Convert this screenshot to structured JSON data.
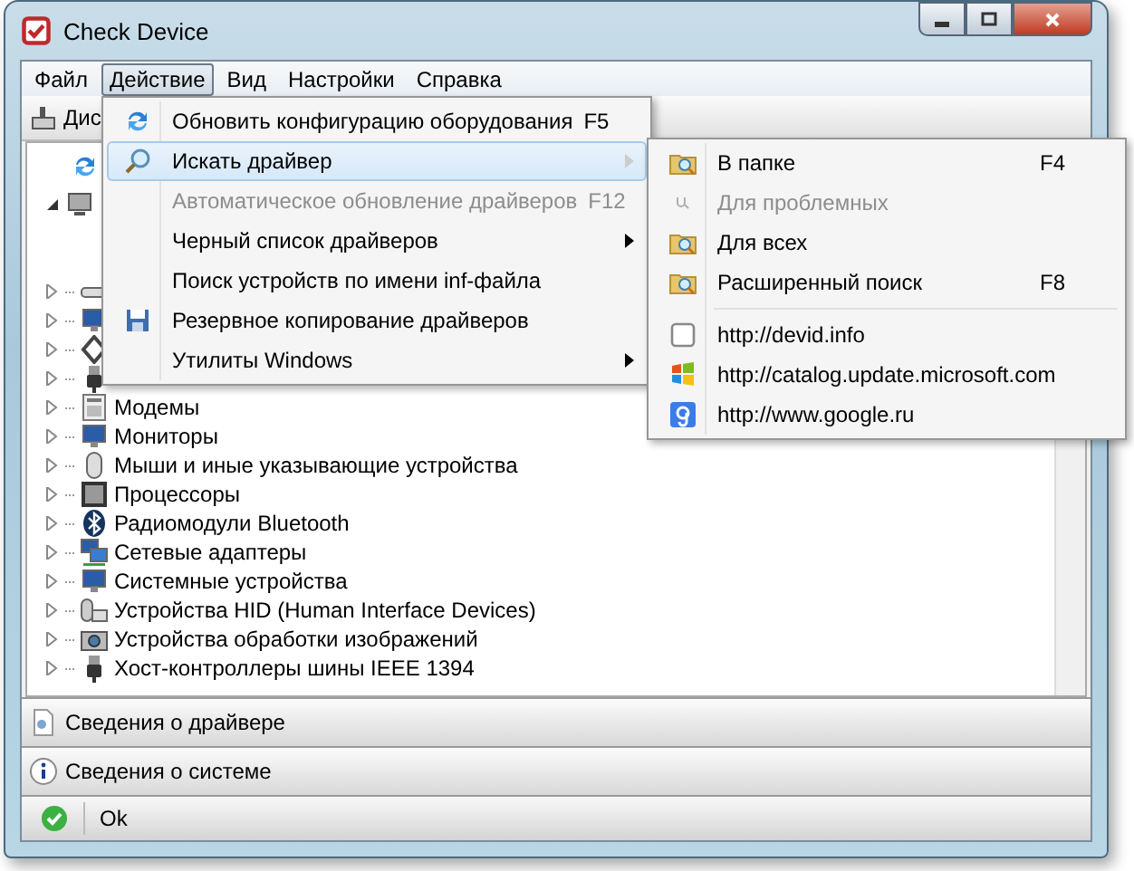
{
  "window": {
    "title": "Check Device"
  },
  "menubar": [
    {
      "label": "Файл",
      "selected": false
    },
    {
      "label": "Действие",
      "selected": true
    },
    {
      "label": "Вид",
      "selected": false
    },
    {
      "label": "Настройки",
      "selected": false
    },
    {
      "label": "Справка",
      "selected": false
    }
  ],
  "toolbar": {
    "label": "Дис"
  },
  "tree": {
    "expanded": true,
    "children": [
      {
        "expanded": false
      },
      {
        "expanded": false
      },
      {
        "expanded": false
      },
      {
        "expanded": false
      },
      {
        "label": "Модемы",
        "expanded": false
      },
      {
        "label": "Мониторы",
        "expanded": false
      },
      {
        "label": "Мыши и иные указывающие устройства",
        "expanded": false
      },
      {
        "label": "Процессоры",
        "expanded": false
      },
      {
        "label": "Радиомодули Bluetooth",
        "expanded": false
      },
      {
        "label": "Сетевые адаптеры",
        "expanded": false
      },
      {
        "label": "Системные устройства",
        "expanded": false
      },
      {
        "label": "Устройства HID (Human Interface Devices)",
        "expanded": false
      },
      {
        "label": "Устройства обработки изображений",
        "expanded": false
      },
      {
        "label": "Хост-контроллеры шины IEEE 1394",
        "expanded": false
      }
    ]
  },
  "menu": [
    {
      "kind": "item",
      "label": "Обновить конфигурацию оборудования",
      "shortcut": "F5",
      "disabled": false,
      "submenu": false,
      "selected": false
    },
    {
      "kind": "item",
      "label": "Искать драйвер",
      "disabled": false,
      "submenu": true,
      "selected": true
    },
    {
      "kind": "item",
      "label": "Автоматическое обновление драйверов",
      "shortcut": "F12",
      "disabled": true,
      "submenu": false,
      "selected": false
    },
    {
      "kind": "item",
      "label": "Черный список драйверов",
      "disabled": false,
      "submenu": true,
      "selected": false
    },
    {
      "kind": "item",
      "label": "Поиск устройств по имени inf-файла",
      "disabled": false,
      "submenu": false,
      "selected": false
    },
    {
      "kind": "item",
      "label": "Резервное копирование драйверов",
      "disabled": false,
      "submenu": false,
      "selected": false
    },
    {
      "kind": "item",
      "label": "Утилиты Windows",
      "disabled": false,
      "submenu": true,
      "selected": false
    }
  ],
  "submenu": [
    {
      "kind": "item",
      "label": "В папке",
      "shortcut": "F4",
      "disabled": false
    },
    {
      "kind": "item",
      "label": "Для проблемных",
      "disabled": true
    },
    {
      "kind": "item",
      "label": "Для всех",
      "disabled": false
    },
    {
      "kind": "item",
      "label": "Расширенный поиск",
      "shortcut": "F8",
      "disabled": false
    },
    {
      "kind": "separator"
    },
    {
      "kind": "item",
      "label": "http://devid.info",
      "disabled": false
    },
    {
      "kind": "item",
      "label": "http://catalog.update.microsoft.com",
      "disabled": false
    },
    {
      "kind": "item",
      "label": "http://www.google.ru",
      "disabled": false
    }
  ],
  "panels": [
    {
      "label": "Сведения о драйвере"
    },
    {
      "label": "Сведения о системе"
    }
  ],
  "status_bar": {
    "text": "Ok"
  }
}
